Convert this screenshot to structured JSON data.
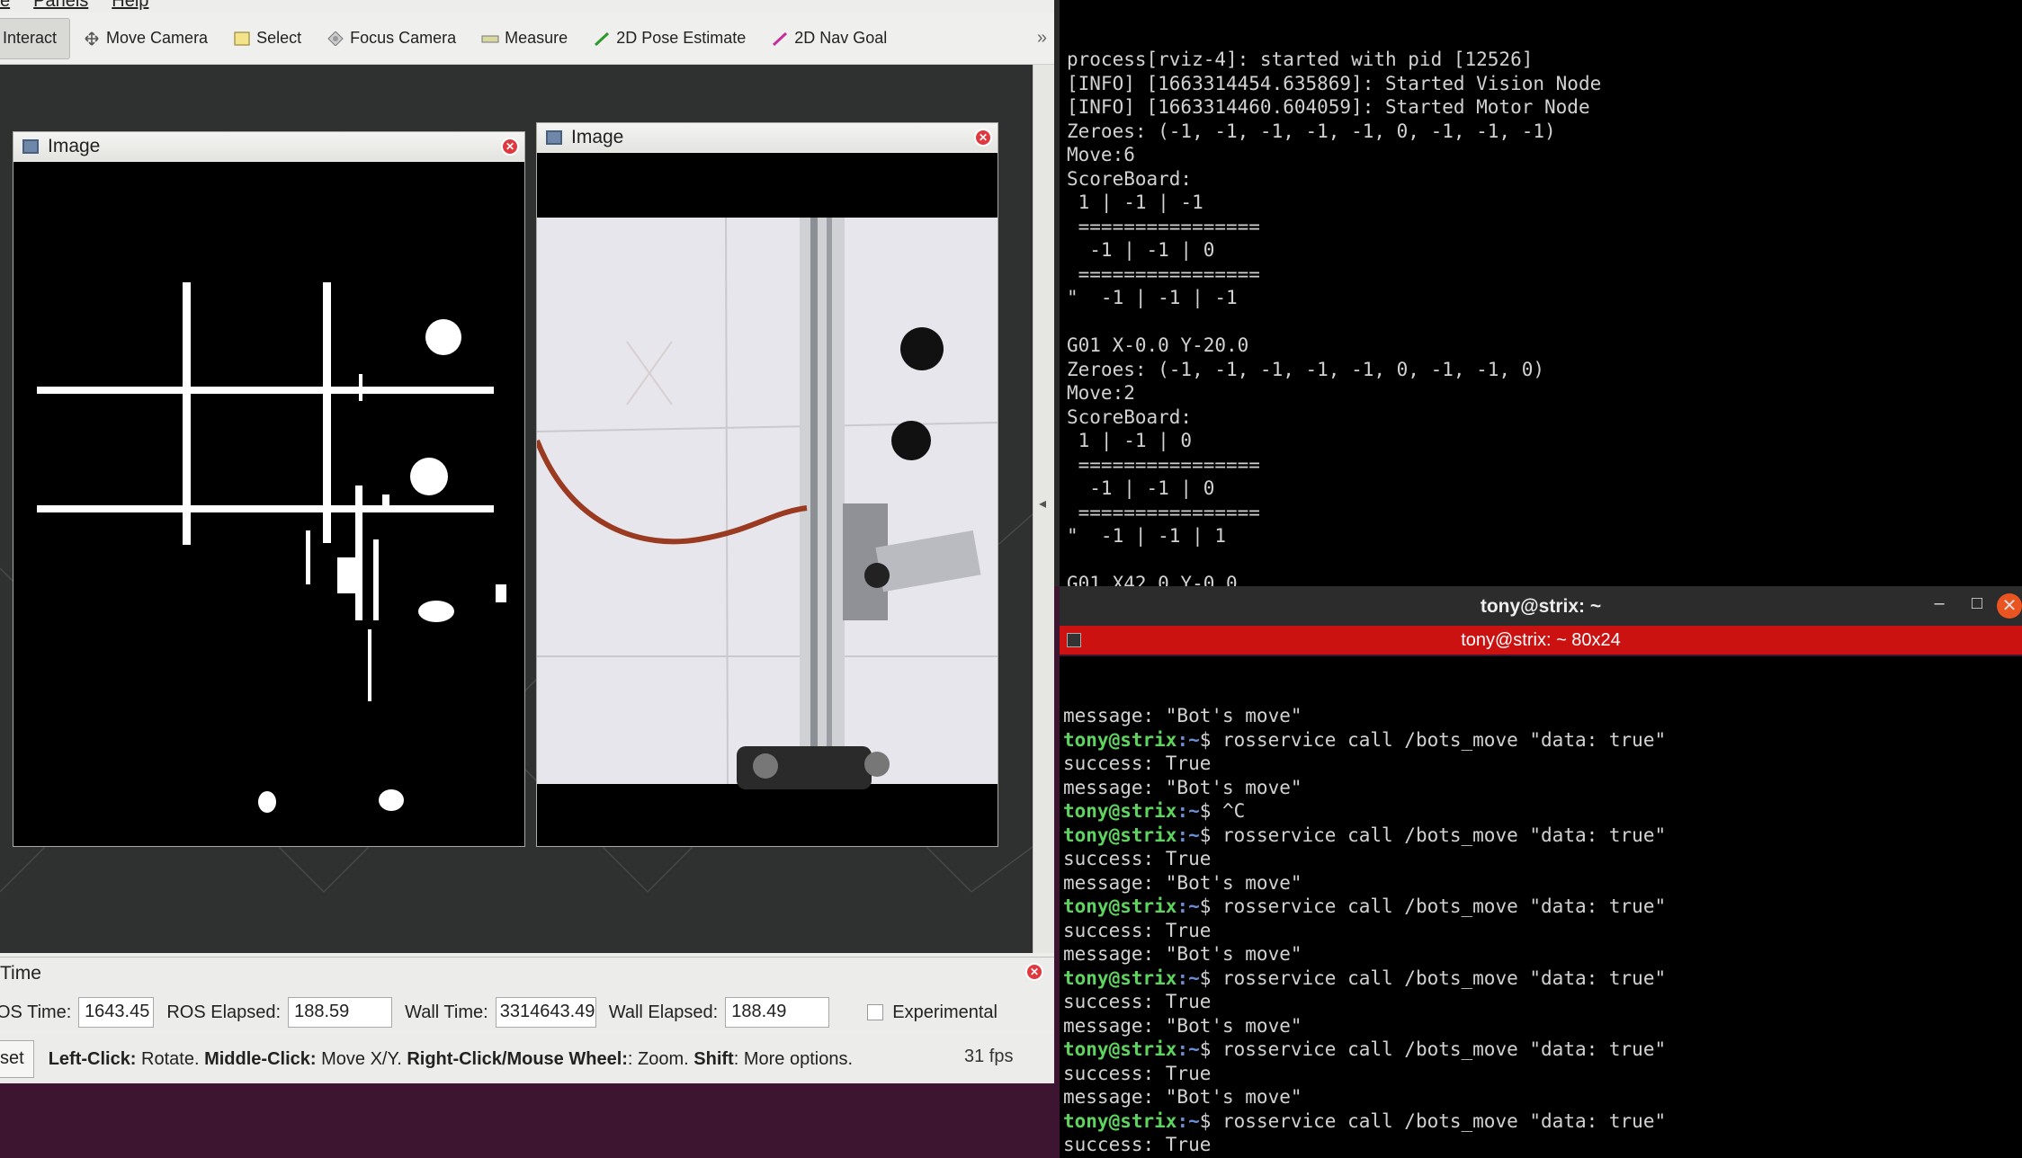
{
  "rviz": {
    "menu": [
      "e",
      "Panels",
      "Help"
    ],
    "toolbar": {
      "interact": "Interact",
      "move_camera": "Move Camera",
      "select": "Select",
      "focus_camera": "Focus Camera",
      "measure": "Measure",
      "pose_estimate": "2D Pose Estimate",
      "nav_goal": "2D Nav Goal",
      "more": "»"
    },
    "panels": {
      "image1_title": "Image",
      "image2_title": "Image"
    },
    "time_panel": {
      "title": "Time",
      "ros_time_label": "OS Time:",
      "ros_time_value": "1643.45",
      "ros_elapsed_label": "ROS Elapsed:",
      "ros_elapsed_value": "188.59",
      "wall_time_label": "Wall Time:",
      "wall_time_value": "3314643.49",
      "wall_elapsed_label": "Wall Elapsed:",
      "wall_elapsed_value": "188.49",
      "experimental_label": "Experimental"
    },
    "status": {
      "reset": "set",
      "left_click": "Left-Click:",
      "left_action": " Rotate. ",
      "middle_click": "Middle-Click:",
      "middle_action": " Move X/Y. ",
      "right_click": "Right-Click/Mouse Wheel:",
      "right_action": ": Zoom. ",
      "shift": "Shift",
      "shift_action": ": More options.",
      "fps": "31 fps"
    }
  },
  "terminal1": {
    "lines": [
      "process[rviz-4]: started with pid [12526]",
      "[INFO] [1663314454.635869]: Started Vision Node",
      "[INFO] [1663314460.604059]: Started Motor Node",
      "Zeroes: (-1, -1, -1, -1, -1, 0, -1, -1, -1)",
      "Move:6",
      "ScoreBoard:",
      " 1 | -1 | -1",
      " ================",
      "  -1 | -1 | 0",
      " ================",
      "\"  -1 | -1 | -1",
      "",
      "G01 X-0.0 Y-20.0",
      "Zeroes: (-1, -1, -1, -1, -1, 0, -1, -1, 0)",
      "Move:2",
      "ScoreBoard:",
      " 1 | -1 | 0",
      " ================",
      "  -1 | -1 | 0",
      " ================",
      "\"  -1 | -1 | 1",
      "",
      "G01 X42.0 Y-0.0"
    ]
  },
  "terminal2": {
    "window_title": "tony@strix: ~",
    "tab_title": "tony@strix: ~ 80x24",
    "prompt_user": "tony@strix",
    "prompt_path": ":~",
    "lines": [
      {
        "type": "out",
        "text": "message: \"Bot's move\""
      },
      {
        "type": "cmd",
        "text": "$ rosservice call /bots_move \"data: true\""
      },
      {
        "type": "out",
        "text": "success: True"
      },
      {
        "type": "out",
        "text": "message: \"Bot's move\""
      },
      {
        "type": "cmd",
        "text": "$ ^C"
      },
      {
        "type": "cmd",
        "text": "$ rosservice call /bots_move \"data: true\""
      },
      {
        "type": "out",
        "text": "success: True"
      },
      {
        "type": "out",
        "text": "message: \"Bot's move\""
      },
      {
        "type": "cmd",
        "text": "$ rosservice call /bots_move \"data: true\""
      },
      {
        "type": "out",
        "text": "success: True"
      },
      {
        "type": "out",
        "text": "message: \"Bot's move\""
      },
      {
        "type": "cmd",
        "text": "$ rosservice call /bots_move \"data: true\""
      },
      {
        "type": "out",
        "text": "success: True"
      },
      {
        "type": "out",
        "text": "message: \"Bot's move\""
      },
      {
        "type": "cmd",
        "text": "$ rosservice call /bots_move \"data: true\""
      },
      {
        "type": "out",
        "text": "success: True"
      },
      {
        "type": "out",
        "text": "message: \"Bot's move\""
      },
      {
        "type": "cmd",
        "text": "$ rosservice call /bots_move \"data: true\""
      },
      {
        "type": "out",
        "text": "success: True"
      },
      {
        "type": "out",
        "text": "message: \"Bot's move\""
      },
      {
        "type": "cmd",
        "text": "$ rosservice call /bots_move \"data: true\""
      }
    ]
  },
  "colors": {
    "prompt_user": "#5fd35f",
    "tab_active": "#cc1111",
    "close_button": "#e95420",
    "desktop": "#3d1530"
  }
}
